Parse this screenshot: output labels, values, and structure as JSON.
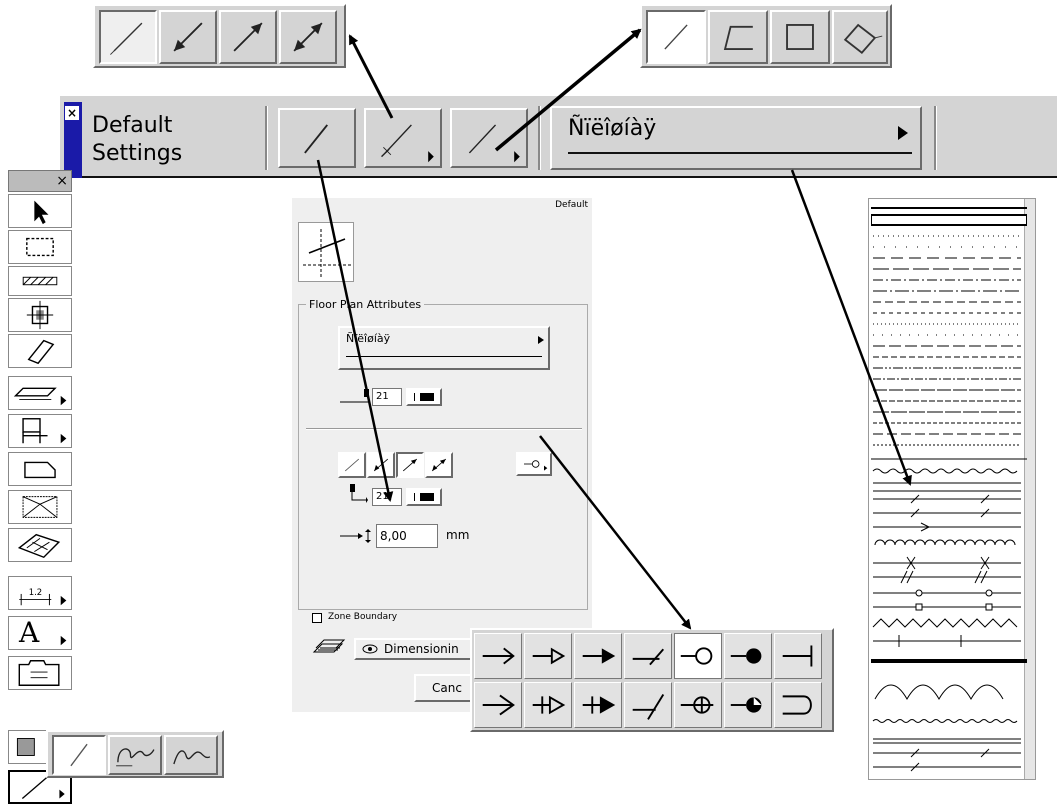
{
  "toolbar": {
    "settings_label_line1": "Default",
    "settings_label_line2": "Settings",
    "linetype_selector": "Ñïëîøíàÿ"
  },
  "toolbox": {
    "close_glyph": "×",
    "text_tool_glyph": "A",
    "dimension_tool_value": "1.2"
  },
  "dialog": {
    "title": "Default",
    "floor_plan_section": "Floor Plan Attributes",
    "linetype_value": "Ñïëîøíàÿ",
    "pen_value_1": "21",
    "pen_value_2": "21",
    "marker_size": "8,00",
    "marker_unit": "mm",
    "zone_boundary_label": "Zone Boundary",
    "dimension_button": "Dimensionin",
    "cancel_button": "Canc"
  },
  "colors": {
    "toolbar_bg": "#d4d4d4",
    "dialog_bg": "#efefef",
    "settings_blue": "#1a1aa8"
  }
}
